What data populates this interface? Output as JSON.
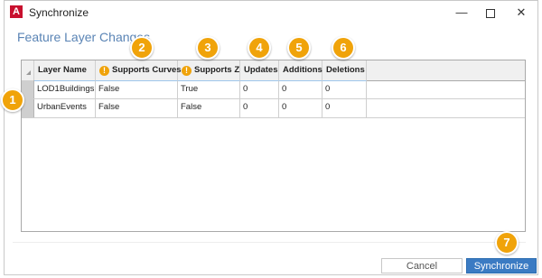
{
  "window": {
    "title": "Synchronize",
    "app_icon_letter": "A",
    "heading": "Feature Layer Changes"
  },
  "grid": {
    "columns": [
      {
        "label": "Layer Name",
        "warning": false
      },
      {
        "label": "Supports Curves",
        "warning": true
      },
      {
        "label": "Supports Z",
        "warning": true
      },
      {
        "label": "Updates",
        "warning": false
      },
      {
        "label": "Additions",
        "warning": false
      },
      {
        "label": "Deletions",
        "warning": false
      }
    ],
    "rows": [
      [
        "LOD1Buildings",
        "False",
        "True",
        "0",
        "0",
        "0"
      ],
      [
        "UrbanEvents",
        "False",
        "False",
        "0",
        "0",
        "0"
      ]
    ]
  },
  "badges": [
    "1",
    "2",
    "3",
    "4",
    "5",
    "6",
    "7"
  ],
  "buttons": {
    "cancel": "Cancel",
    "synchronize": "Synchronize"
  },
  "colors": {
    "badge": "#f0a30a",
    "heading": "#5a84b5",
    "primary_button": "#3b7bc3",
    "app_icon": "#c8102e"
  }
}
